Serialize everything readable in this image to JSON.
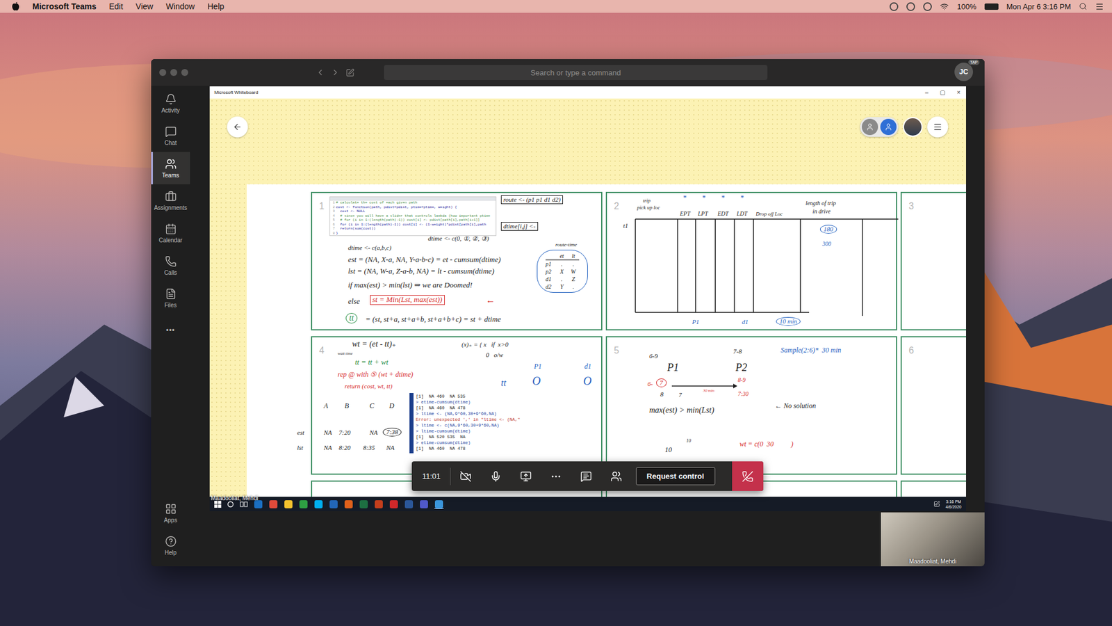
{
  "menu_bar": {
    "app": "Microsoft Teams",
    "items": [
      "Edit",
      "View",
      "Window",
      "Help"
    ],
    "battery": "100%",
    "clock": "Mon Apr 6  3:16 PM"
  },
  "teams": {
    "search": {
      "placeholder": "Search or type a command"
    },
    "avatar": {
      "initials": "JC",
      "badge": "TAP"
    },
    "rail": [
      {
        "label": "Activity",
        "selected": false
      },
      {
        "label": "Chat",
        "selected": false
      },
      {
        "label": "Teams",
        "selected": true
      },
      {
        "label": "Assignments",
        "selected": false
      },
      {
        "label": "Calendar",
        "selected": false
      },
      {
        "label": "Calls",
        "selected": false
      },
      {
        "label": "Files",
        "selected": false
      }
    ],
    "rail_more": "•••",
    "rail_bottom": [
      {
        "label": "Apps"
      },
      {
        "label": "Help"
      }
    ]
  },
  "whiteboard": {
    "title": "Microsoft Whiteboard",
    "window_controls": [
      "–",
      "▢",
      "×"
    ],
    "panels": [
      {
        "number": "1",
        "code": [
          {
            "no": "1",
            "line": "# calculate the cost of each given path"
          },
          {
            "no": "2",
            "line": "cost <- function(path, pdist=pdist, ptime=ptime, weight) {"
          },
          {
            "no": "3",
            "line": "  cost <- NULL"
          },
          {
            "no": "4",
            "line": "  # since you will have a slider that controls lambda (how important ptime"
          },
          {
            "no": "5",
            "line": "  # for (i in 1:(length(path)-1)) cost[i] <- pdist[path[i],path[i+1]]"
          },
          {
            "no": "6",
            "line": "  for (i in 1:(length(path)-1)) cost[i] <- (1-weight)*pdist[path[i],path"
          },
          {
            "no": "7",
            "line": "  return(sum(cost))"
          },
          {
            "no": "8",
            "line": "}"
          }
        ],
        "table": {
          "columns": [
            "et",
            "lt"
          ],
          "rows": [
            {
              "label": "p1",
              "cells": [
                ".",
                "."
              ]
            },
            {
              "label": "p2",
              "cells": [
                "X",
                "W"
              ]
            },
            {
              "label": "d1",
              "cells": [
                ".",
                "Z"
              ]
            },
            {
              "label": "d2",
              "cells": [
                "Y",
                "."
              ]
            }
          ]
        },
        "notes": [
          {
            "text": "route <- (p1 p1 d1 d2)",
            "color": "#1a1a1a",
            "kind": "boxed"
          },
          {
            "text": "dtime[i,j] <-",
            "color": "#1a1a1a",
            "kind": "boxed"
          },
          {
            "text": "route-time",
            "color": "#1a1a1a",
            "kind": "plain"
          },
          {
            "text": "dtime <- c(a,b,c)",
            "color": "#1a1a1a",
            "kind": "plain"
          },
          {
            "text": "dtime <- c(0, ①, ②, ③)",
            "color": "#1a1a1a",
            "kind": "plain"
          },
          {
            "text": "est = (NA, X-a, NA, Y-a-b-c) = et - cumsum(dtime)",
            "color": "#1a1a1a",
            "kind": "plain"
          },
          {
            "text": "lst = (NA, W-a, Z-a-b, NA) = lt - cumsum(dtime)",
            "color": "#1a1a1a",
            "kind": "plain"
          },
          {
            "text": "if max(est) > min(lst) ⇒ we are Doomed!",
            "color": "#1a1a1a",
            "kind": "plain"
          },
          {
            "text": "else",
            "color": "#1a1a1a",
            "kind": "plain"
          },
          {
            "text": "st = Min(Lst, max(est))",
            "color": "#d62b2b",
            "kind": "boxed"
          },
          {
            "text": "←",
            "color": "#d62b2b",
            "kind": "plain"
          },
          {
            "text": "tt",
            "color": "#1c8a3a",
            "kind": "circled"
          },
          {
            "text": "= (st, st+a, st+a+b, st+a+b+c) = st + dtime",
            "color": "#1a1a1a",
            "kind": "plain"
          }
        ]
      },
      {
        "number": "2",
        "notes": [
          {
            "text": "trip",
            "color": "#1a1a1a",
            "kind": "plain"
          },
          {
            "text": "pick up loc",
            "color": "#1a1a1a",
            "kind": "plain"
          },
          {
            "text": "EPT",
            "color": "#1a1a1a",
            "kind": "plain"
          },
          {
            "text": "LPT",
            "color": "#1a1a1a",
            "kind": "plain"
          },
          {
            "text": "EDT",
            "color": "#1a1a1a",
            "kind": "plain"
          },
          {
            "text": "LDT",
            "color": "#1a1a1a",
            "kind": "plain"
          },
          {
            "text": "Drop off Loc",
            "color": "#1a1a1a",
            "kind": "plain"
          },
          {
            "text": "length of trip",
            "color": "#1a1a1a",
            "kind": "plain"
          },
          {
            "text": "in drive",
            "color": "#1a1a1a",
            "kind": "plain"
          },
          {
            "text": "180",
            "color": "#1f5fbf",
            "kind": "circled"
          },
          {
            "text": "300",
            "color": "#1f5fbf",
            "kind": "plain"
          },
          {
            "text": "t1",
            "color": "#1a1a1a",
            "kind": "plain"
          },
          {
            "text": "P1",
            "color": "#1f5fbf",
            "kind": "plain"
          },
          {
            "text": "d1",
            "color": "#1f5fbf",
            "kind": "plain"
          },
          {
            "text": "10 min",
            "color": "#1f5fbf",
            "kind": "circled"
          },
          {
            "text": "*",
            "color": "#1f5fbf",
            "kind": "plain"
          },
          {
            "text": "*",
            "color": "#1f5fbf",
            "kind": "plain"
          },
          {
            "text": "*",
            "color": "#1f5fbf",
            "kind": "plain"
          },
          {
            "text": "*",
            "color": "#1f5fbf",
            "kind": "plain"
          }
        ]
      },
      {
        "number": "3",
        "notes": []
      },
      {
        "number": "4",
        "console": [
          "[1]  NA 460  NA 535",
          "> etime-cumsum(dtime)",
          "[1]  NA 460  NA 478",
          "> ltime <- (NA,9*60,30+9*60,NA)",
          "Error: unexpected ',' in \"ltime <- (NA,\"",
          "> ltime <- c(NA,9*60,30+9*60,NA)",
          "> ltime-cumsum(dtime)",
          "[1]  NA 520 535  NA",
          "> etime-cumsum(dtime)",
          "[1]  NA 460  NA 478"
        ],
        "notes": [
          {
            "text": "wt = (et - tt)₊",
            "color": "#1a1a1a",
            "kind": "plain"
          },
          {
            "text": "wait time",
            "color": "#1a1a1a",
            "kind": "plain"
          },
          {
            "text": "tt = tt + wt",
            "color": "#1c8a3a",
            "kind": "plain"
          },
          {
            "text": "(x)₊ = { x   if  x>0",
            "color": "#1a1a1a",
            "kind": "plain"
          },
          {
            "text": "0   o/w",
            "color": "#1a1a1a",
            "kind": "plain"
          },
          {
            "text": "rep @ with ⑤ (wt + dtime)",
            "color": "#d62b2b",
            "kind": "plain"
          },
          {
            "text": "return (cost, wt, tt)",
            "color": "#d62b2b",
            "kind": "plain"
          },
          {
            "text": "P1",
            "color": "#1f5fbf",
            "kind": "plain"
          },
          {
            "text": "d1",
            "color": "#1f5fbf",
            "kind": "plain"
          },
          {
            "text": "tt",
            "color": "#1f5fbf",
            "kind": "plain"
          },
          {
            "text": "O",
            "color": "#1f5fbf",
            "kind": "plain"
          },
          {
            "text": "O",
            "color": "#1f5fbf",
            "kind": "plain"
          },
          {
            "text": "A",
            "color": "#1a1a1a",
            "kind": "plain"
          },
          {
            "text": "B",
            "color": "#1a1a1a",
            "kind": "plain"
          },
          {
            "text": "C",
            "color": "#1a1a1a",
            "kind": "plain"
          },
          {
            "text": "D",
            "color": "#1a1a1a",
            "kind": "plain"
          },
          {
            "text": "est",
            "color": "#1a1a1a",
            "kind": "plain"
          },
          {
            "text": "NA",
            "color": "#1a1a1a",
            "kind": "plain"
          },
          {
            "text": "7:20",
            "color": "#1a1a1a",
            "kind": "plain"
          },
          {
            "text": "NA",
            "color": "#1a1a1a",
            "kind": "plain"
          },
          {
            "text": "7:38",
            "color": "#1a1a1a",
            "kind": "circled"
          },
          {
            "text": "lst",
            "color": "#1a1a1a",
            "kind": "plain"
          },
          {
            "text": "NA",
            "color": "#1a1a1a",
            "kind": "plain"
          },
          {
            "text": "8:20",
            "color": "#1a1a1a",
            "kind": "plain"
          },
          {
            "text": "8:35",
            "color": "#1a1a1a",
            "kind": "plain"
          },
          {
            "text": "NA",
            "color": "#1a1a1a",
            "kind": "plain"
          }
        ]
      },
      {
        "number": "5",
        "notes": [
          {
            "text": "6-9",
            "color": "#1a1a1a",
            "kind": "plain"
          },
          {
            "text": "P1",
            "color": "#1a1a1a",
            "kind": "plain"
          },
          {
            "text": "7-8",
            "color": "#1a1a1a",
            "kind": "plain"
          },
          {
            "text": "P2",
            "color": "#1a1a1a",
            "kind": "plain"
          },
          {
            "text": "Sample(2:6)*  30 min",
            "color": "#1f5fbf",
            "kind": "plain"
          },
          {
            "text": "6-",
            "color": "#d62b2b",
            "kind": "plain"
          },
          {
            "text": "7",
            "color": "#d62b2b",
            "kind": "circled"
          },
          {
            "text": "30 min",
            "color": "#d62b2b",
            "kind": "plain"
          },
          {
            "text": "8-9",
            "color": "#d62b2b",
            "kind": "plain"
          },
          {
            "text": "7:30",
            "color": "#d62b2b",
            "kind": "plain"
          },
          {
            "text": "8",
            "color": "#1a1a1a",
            "kind": "plain"
          },
          {
            "text": "7",
            "color": "#1a1a1a",
            "kind": "plain"
          },
          {
            "text": "max(est) > min(Lst)",
            "color": "#1a1a1a",
            "kind": "plain"
          },
          {
            "text": "← No solution",
            "color": "#1a1a1a",
            "kind": "plain"
          },
          {
            "text": "10",
            "color": "#1a1a1a",
            "kind": "plain"
          },
          {
            "text": "10",
            "color": "#1a1a1a",
            "kind": "plain"
          },
          {
            "text": "wt = c(0  30          )",
            "color": "#d62b2b",
            "kind": "plain"
          }
        ]
      },
      {
        "number": "6",
        "notes": []
      }
    ]
  },
  "taskbar": {
    "time": "3:16 PM",
    "date": "4/6/2020"
  },
  "presenter": "Maadooliat, Mehdi",
  "call": {
    "duration": "11:01",
    "request_control": "Request control"
  },
  "self_video": {
    "label": "Maadooliat, Mehdi"
  }
}
